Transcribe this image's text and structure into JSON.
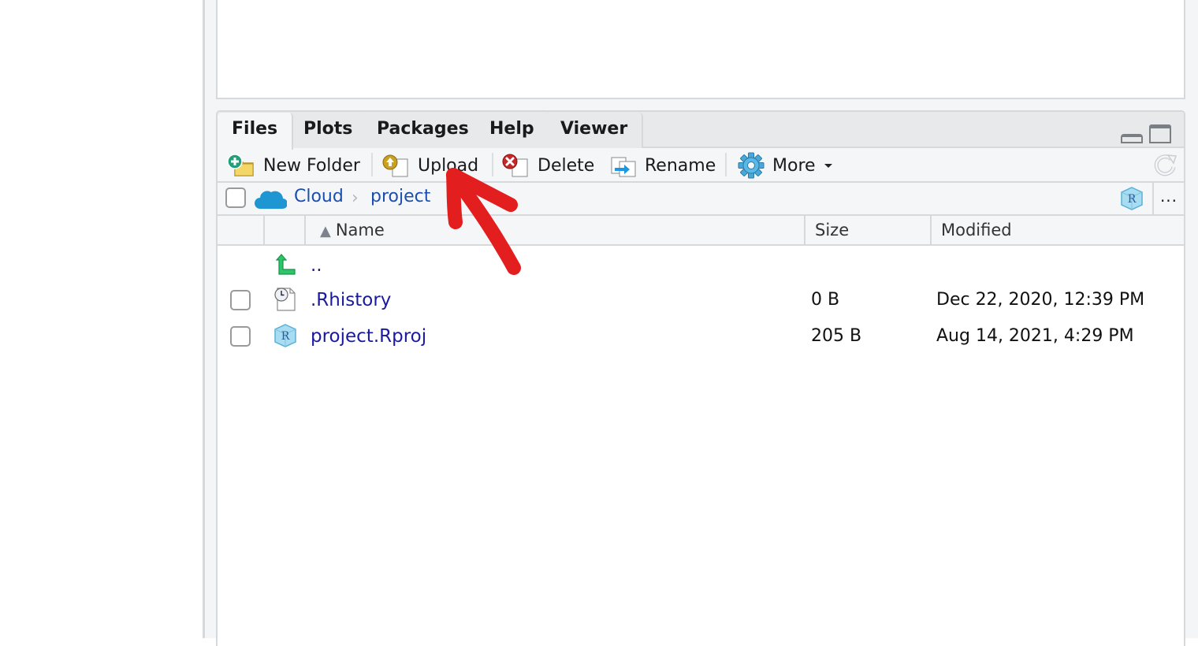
{
  "tabs": [
    {
      "label": "Files",
      "active": true
    },
    {
      "label": "Plots",
      "active": false
    },
    {
      "label": "Packages",
      "active": false
    },
    {
      "label": "Help",
      "active": false
    },
    {
      "label": "Viewer",
      "active": false
    }
  ],
  "toolbar": {
    "new_folder": "New Folder",
    "upload": "Upload",
    "delete": "Delete",
    "rename": "Rename",
    "more": "More"
  },
  "path": {
    "crumbs": [
      "Cloud",
      "project"
    ],
    "separator": "›",
    "more": "..."
  },
  "columns": {
    "name": "Name",
    "size": "Size",
    "modified": "Modified",
    "sort_indicator": "▲"
  },
  "files": [
    {
      "name": "..",
      "size": "",
      "modified": "",
      "icon": "parent-folder-icon"
    },
    {
      "name": ".Rhistory",
      "size": "0 B",
      "modified": "Dec 22, 2020, 12:39 PM",
      "icon": "history-file-icon"
    },
    {
      "name": "project.Rproj",
      "size": "205 B",
      "modified": "Aug 14, 2021, 4:29 PM",
      "icon": "rproj-file-icon"
    }
  ],
  "colors": {
    "link": "#1a1aa0",
    "breadcrumb": "#1a4fb0",
    "annotation": "#e31e1e",
    "cloud": "#1e96d2"
  }
}
